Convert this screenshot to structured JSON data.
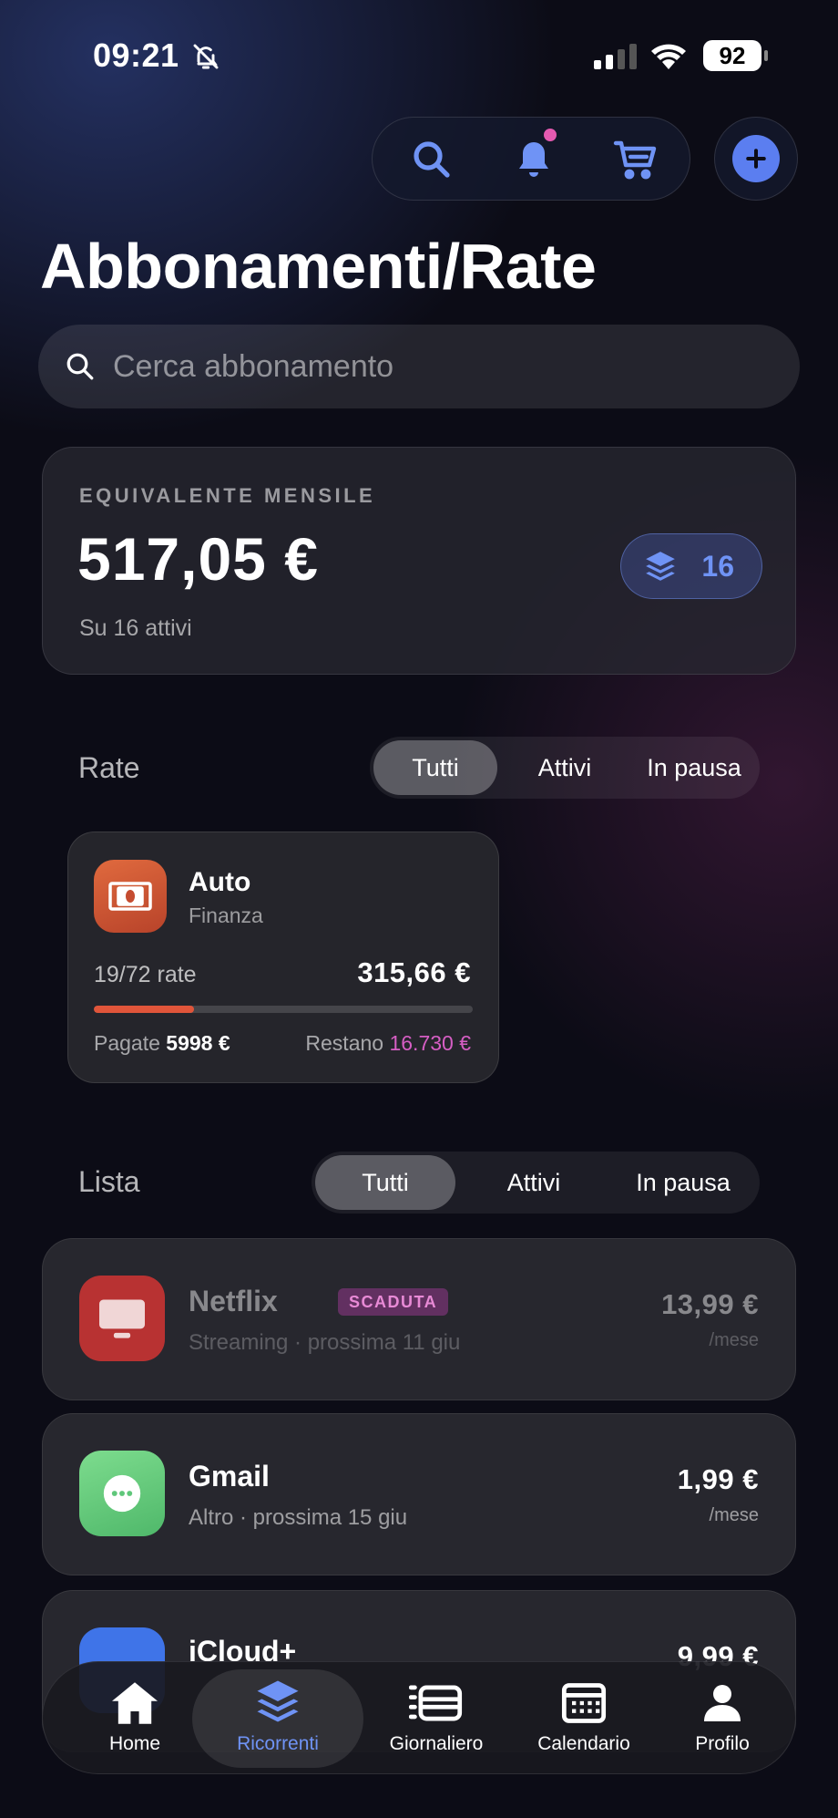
{
  "status_bar": {
    "time": "09:21",
    "battery": "92"
  },
  "header": {
    "title": "Abbonamenti/Rate"
  },
  "search": {
    "placeholder": "Cerca abbonamento"
  },
  "summary": {
    "label": "EQUIVALENTE MENSILE",
    "amount": "517,05 €",
    "subtitle": "Su 16 attivi",
    "count": "16"
  },
  "rate_section": {
    "title": "Rate",
    "filters": [
      "Tutti",
      "Attivi",
      "In pausa"
    ],
    "active_filter": "Tutti",
    "card": {
      "name": "Auto",
      "category": "Finanza",
      "installments": "19/72 rate",
      "amount": "315,66 €",
      "progress": 0.264,
      "paid_label": "Pagate",
      "paid_value": "5998 €",
      "left_label": "Restano",
      "left_value": "16.730 €"
    }
  },
  "list_section": {
    "title": "Lista",
    "filters": [
      "Tutti",
      "Attivi",
      "In pausa"
    ],
    "active_filter": "Tutti",
    "items": [
      {
        "name": "Netflix",
        "badge": "SCADUTA",
        "subtitle": "Streaming · prossima 11 giu",
        "price": "13,99 €",
        "period": "/mese",
        "icon": "tv-icon",
        "color": "#b83232"
      },
      {
        "name": "Gmail",
        "subtitle": "Altro · prossima 15 giu",
        "price": "1,99 €",
        "period": "/mese",
        "icon": "more-dots-icon",
        "color": "#5fc77a"
      },
      {
        "name": "iCloud+",
        "price": "9,99 €",
        "icon": "cloud-icon",
        "color": "#3f74e8"
      }
    ]
  },
  "tabbar": {
    "tabs": [
      {
        "label": "Home",
        "icon": "house-icon"
      },
      {
        "label": "Ricorrenti",
        "icon": "layers-icon"
      },
      {
        "label": "Giornaliero",
        "icon": "daily-list-icon"
      },
      {
        "label": "Calendario",
        "icon": "calendar-icon"
      },
      {
        "label": "Profilo",
        "icon": "person-icon"
      }
    ],
    "active": "Ricorrenti"
  },
  "colors": {
    "accent": "#5b7ef0",
    "accent_text": "#6f93f5",
    "danger": "#e0553a",
    "pink": "#d65ec4"
  }
}
